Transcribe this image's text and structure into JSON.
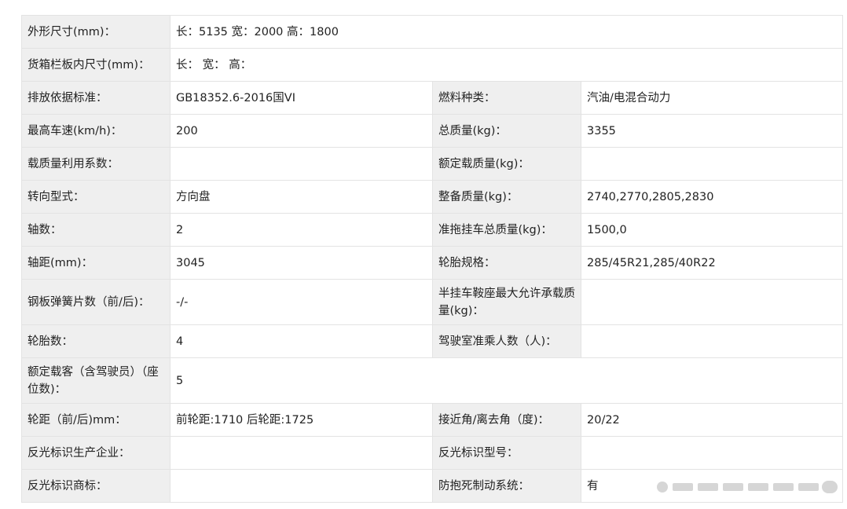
{
  "rows": [
    {
      "cells": [
        {
          "l": "外形尺寸(mm)："
        },
        {
          "v": "长：5135 宽：2000 高：1800",
          "span": 3
        }
      ]
    },
    {
      "cells": [
        {
          "l": "货箱栏板内尺寸(mm)："
        },
        {
          "v": "长： 宽： 高：",
          "span": 3
        }
      ]
    },
    {
      "cells": [
        {
          "l": "排放依据标准："
        },
        {
          "v": "GB18352.6-2016国VI"
        },
        {
          "l": "燃料种类："
        },
        {
          "v": "汽油/电混合动力"
        }
      ]
    },
    {
      "cells": [
        {
          "l": "最高车速(km/h)："
        },
        {
          "v": "200"
        },
        {
          "l": "总质量(kg)："
        },
        {
          "v": "3355"
        }
      ]
    },
    {
      "cells": [
        {
          "l": "载质量利用系数："
        },
        {
          "v": ""
        },
        {
          "l": "额定载质量(kg)："
        },
        {
          "v": ""
        }
      ]
    },
    {
      "cells": [
        {
          "l": "转向型式："
        },
        {
          "v": "方向盘"
        },
        {
          "l": "整备质量(kg)："
        },
        {
          "v": "2740,2770,2805,2830"
        }
      ]
    },
    {
      "cells": [
        {
          "l": "轴数："
        },
        {
          "v": "2"
        },
        {
          "l": "准拖挂车总质量(kg)："
        },
        {
          "v": "1500,0"
        }
      ]
    },
    {
      "cells": [
        {
          "l": "轴距(mm)："
        },
        {
          "v": "3045"
        },
        {
          "l": "轮胎规格："
        },
        {
          "v": "285/45R21,285/40R22"
        }
      ]
    },
    {
      "cells": [
        {
          "l": "钢板弹簧片数（前/后)："
        },
        {
          "v": "-/-"
        },
        {
          "l": "半挂车鞍座最大允许承载质量(kg)："
        },
        {
          "v": ""
        }
      ]
    },
    {
      "cells": [
        {
          "l": "轮胎数："
        },
        {
          "v": "4"
        },
        {
          "l": "驾驶室准乘人数（人)："
        },
        {
          "v": ""
        }
      ]
    },
    {
      "cells": [
        {
          "l": "额定载客（含驾驶员）（座位数)："
        },
        {
          "v": "5",
          "span": 3
        }
      ]
    },
    {
      "cells": [
        {
          "l": "轮距（前/后)mm："
        },
        {
          "v": "前轮距:1710 后轮距:1725"
        },
        {
          "l": "接近角/离去角（度)："
        },
        {
          "v": "20/22"
        }
      ]
    },
    {
      "cells": [
        {
          "l": "反光标识生产企业："
        },
        {
          "v": ""
        },
        {
          "l": "反光标识型号："
        },
        {
          "v": ""
        }
      ]
    },
    {
      "cells": [
        {
          "l": "反光标识商标："
        },
        {
          "v": ""
        },
        {
          "l": "防抱死制动系统："
        },
        {
          "v": "有"
        }
      ]
    }
  ]
}
